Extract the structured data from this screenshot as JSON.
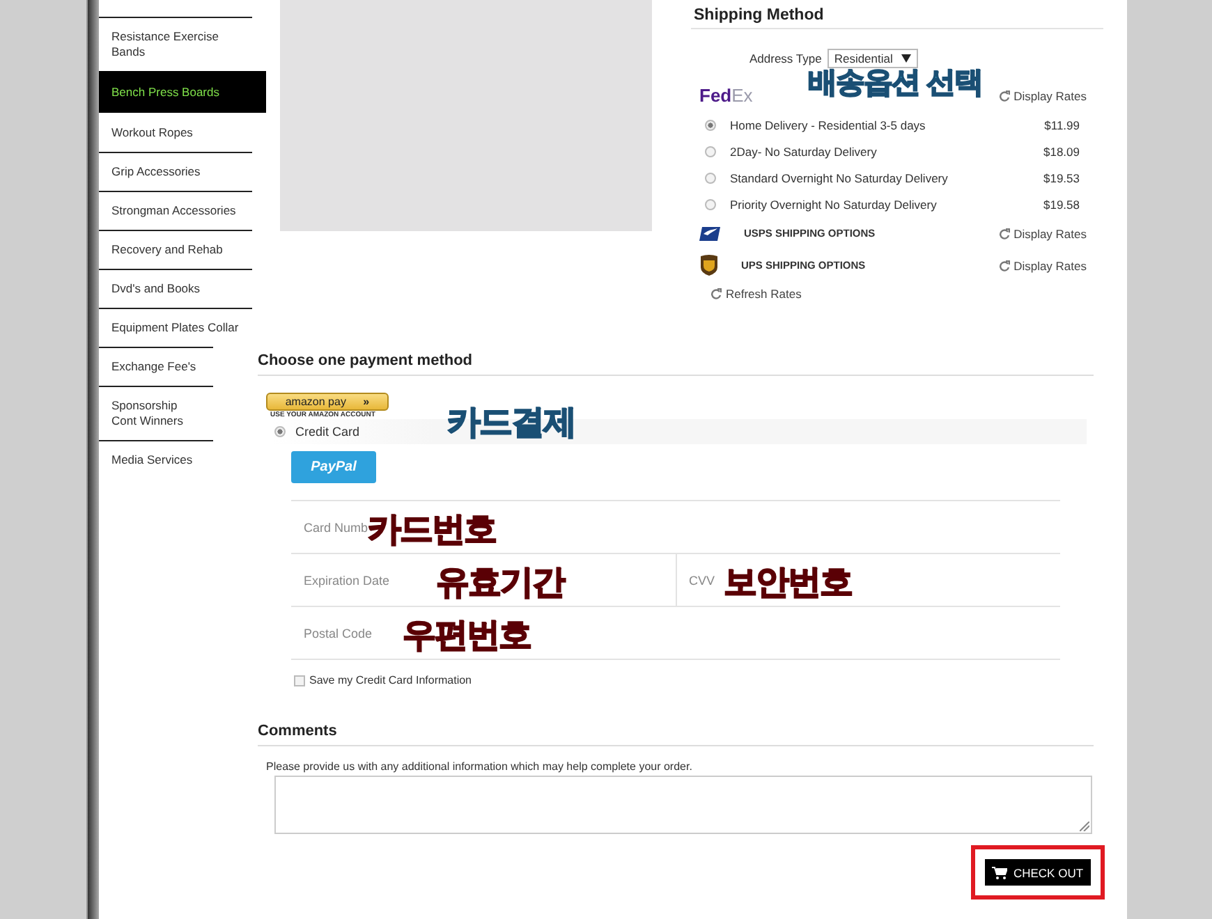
{
  "sidebar": {
    "items": [
      {
        "label": "Resistance Exercise Bands",
        "selected": false
      },
      {
        "label": "Bench Press Boards",
        "selected": true
      },
      {
        "label": "Workout Ropes",
        "selected": false
      },
      {
        "label": "Grip Accessories",
        "selected": false
      },
      {
        "label": "Strongman Accessories",
        "selected": false
      },
      {
        "label": "Recovery and Rehab",
        "selected": false
      },
      {
        "label": "Dvd's and Books",
        "selected": false
      },
      {
        "label": "Equipment Plates Collar",
        "selected": false
      },
      {
        "label": "Exchange Fee's",
        "selected": false
      },
      {
        "label": "Sponsorship Cont Winners",
        "selected": false
      },
      {
        "label": "Media Services",
        "selected": false
      }
    ]
  },
  "shipping": {
    "title": "Shipping Method",
    "address_type_label": "Address Type",
    "address_type_value": "Residential",
    "annotation": "배송옵션 선택",
    "carriers": [
      {
        "kind": "fedex",
        "logo": "FedEx",
        "action": "Display Rates",
        "options": [
          {
            "label": "Home Delivery - Residential 3-5 days",
            "price": "$11.99",
            "selected": true
          },
          {
            "label": "2Day- No Saturday Delivery",
            "price": "$18.09",
            "selected": false
          },
          {
            "label": "Standard Overnight No Saturday Delivery",
            "price": "$19.53",
            "selected": false
          },
          {
            "label": "Priority Overnight No Saturday Delivery",
            "price": "$19.58",
            "selected": false
          }
        ]
      },
      {
        "kind": "usps",
        "label": "USPS SHIPPING OPTIONS",
        "action": "Display Rates"
      },
      {
        "kind": "ups",
        "label": "UPS SHIPPING OPTIONS",
        "action": "Display Rates"
      }
    ],
    "refresh": "Refresh Rates"
  },
  "payment": {
    "title": "Choose one payment method",
    "amazon": {
      "label": "amazon pay",
      "chevron": "»",
      "caption": "USE YOUR AMAZON ACCOUNT"
    },
    "method": {
      "label": "Credit Card",
      "selected": true,
      "annotation": "카드결제"
    },
    "paypal": "PayPal",
    "rows": [
      [
        {
          "label": "Card Numb",
          "annotation": "카드번호"
        }
      ],
      [
        {
          "label": "Expiration Date",
          "annotation": "유효기간"
        },
        {
          "label": "CVV",
          "annotation": "보안번호"
        }
      ],
      [
        {
          "label": "Postal Code",
          "annotation": "우편번호"
        }
      ]
    ],
    "save": {
      "label": "Save my Credit Card Information",
      "checked": false
    }
  },
  "comments": {
    "title": "Comments",
    "prompt": "Please provide us with any additional information which may help complete your order."
  },
  "checkout": {
    "label": "CHECK OUT",
    "highlighted": true
  }
}
